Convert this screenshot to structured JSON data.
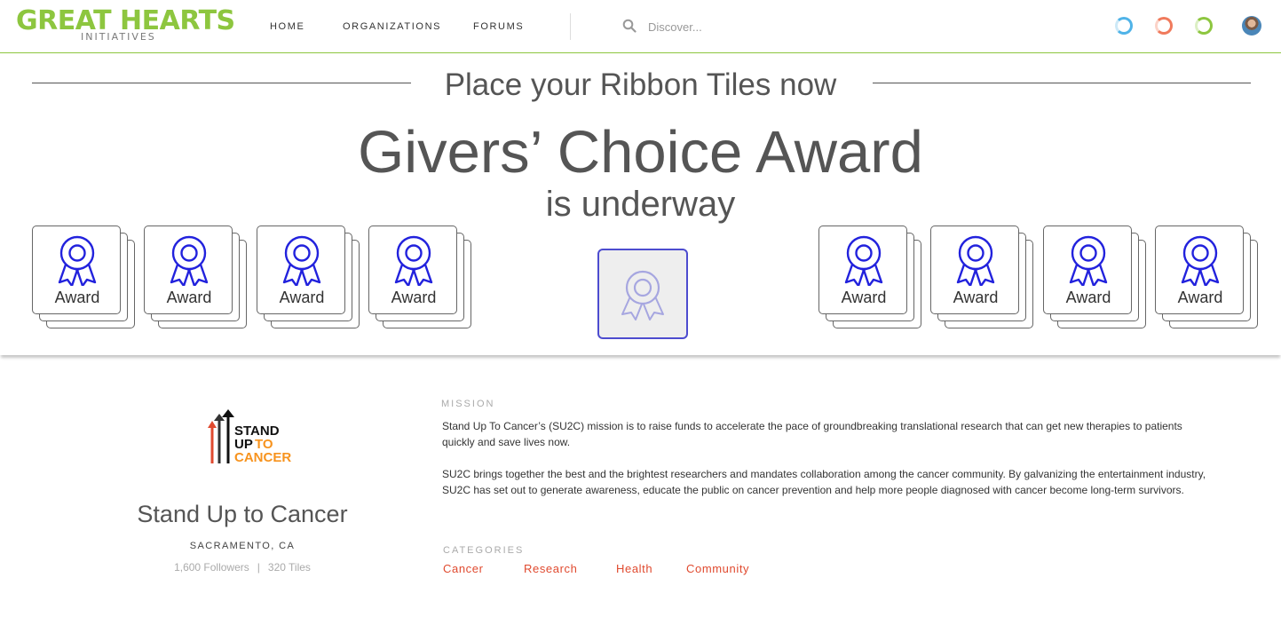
{
  "header": {
    "logo_main": "GREAT HEARTS",
    "logo_sub": "INITIATIVES",
    "nav": [
      "HOME",
      "ORGANIZATIONS",
      "FORUMS"
    ],
    "search_placeholder": "Discover...",
    "status_rings": [
      {
        "icon": "ring-icon",
        "color": "#4fb3e8"
      },
      {
        "icon": "ring-icon",
        "color": "#f07a5c"
      },
      {
        "icon": "ring-icon",
        "color": "#8dc63f"
      }
    ]
  },
  "banner": {
    "top_text": "Place your Ribbon Tiles now",
    "title": "Givers’ Choice Award",
    "subtitle": "is underway",
    "tile_label": "Award",
    "left_tiles": [
      "Award",
      "Award",
      "Award",
      "Award"
    ],
    "right_tiles": [
      "Award",
      "Award",
      "Award",
      "Award"
    ],
    "accent_color": "#2222dd"
  },
  "organization": {
    "logo_lines": [
      "STAND",
      "UP",
      "TO",
      "CANCER"
    ],
    "name": "Stand Up to Cancer",
    "location": "SACRAMENTO, CA",
    "followers": "1,600 Followers",
    "separator": "|",
    "tiles": "320 Tiles",
    "mission_label": "MISSION",
    "mission": [
      "Stand Up To Cancer’s (SU2C) mission is to raise funds to accelerate the pace of groundbreaking translational research that can get new therapies to patients quickly and save lives now.",
      "SU2C brings together the best and the brightest researchers and mandates collaboration among the cancer community. By galvanizing the entertainment industry, SU2C has set out to generate awareness, educate the public on cancer prevention and help more people diagnosed with cancer become long-term survivors."
    ],
    "categories_label": "CATEGORIES",
    "categories": [
      "Cancer",
      "Research",
      "Health",
      "Community"
    ],
    "category_color": "#e04a2f"
  }
}
